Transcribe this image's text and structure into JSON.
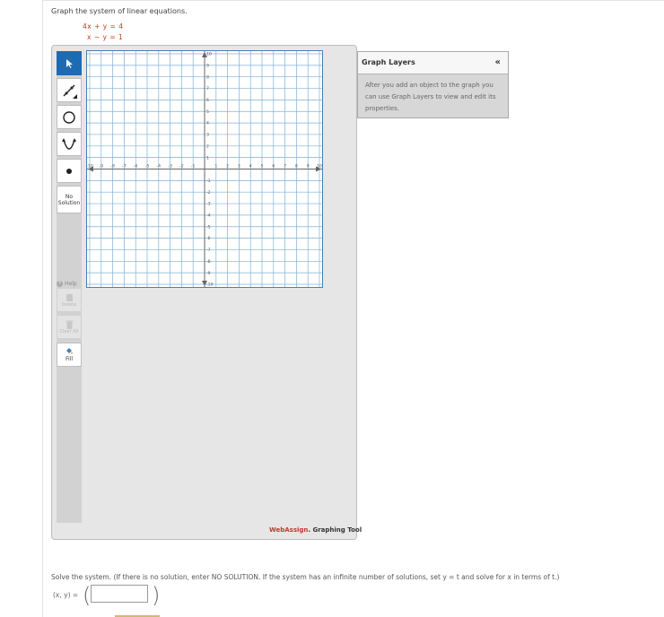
{
  "question": {
    "prompt": "Graph the system of linear equations.",
    "equations": [
      "4x + y = 4",
      "x − y = 1"
    ]
  },
  "toolbar": {
    "no_solution_line1": "No",
    "no_solution_line2": "Solution",
    "help_label": "Help",
    "disabled_1": "Delete",
    "disabled_2": "Clear All",
    "fill_label": "Fill"
  },
  "graph": {
    "x_range": [
      -10,
      10
    ],
    "y_range": [
      -10,
      10
    ],
    "grid": true
  },
  "graph_layers": {
    "title": "Graph Layers",
    "collapse_icon": "«",
    "description": "After you add an object to the graph you can use Graph Layers to view and edit its properties."
  },
  "brand": {
    "web": "Web",
    "assign": "Assign",
    "rest": ". Graphing Tool"
  },
  "solve": {
    "instruction": "Solve the system. (If there is no solution, enter NO SOLUTION. If the system has an infinite number of solutions, set  y = t  and solve for x in terms of t.)",
    "answer_label": "(x, y) =",
    "answer_value": "",
    "open_paren": "(",
    "close_paren": ")"
  },
  "colors": {
    "accent": "#1d6bb3",
    "grid": "#7fb2d6",
    "equation": "#c23b22"
  }
}
